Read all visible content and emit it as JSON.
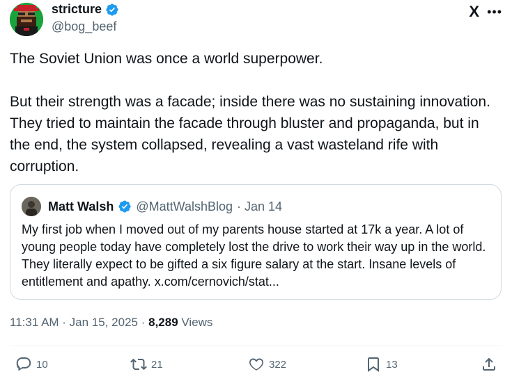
{
  "author": {
    "display_name": "stricture",
    "handle": "@bog_beef",
    "avatar_icon": "pixel-art-avatar",
    "verified_icon": "verified-badge-icon"
  },
  "top_icons": {
    "brand": "X",
    "more": "•••"
  },
  "tweet": {
    "paragraph_1": "The Soviet Union was once a world superpower.",
    "paragraph_2": "But their strength was a facade; inside there was no sustaining innovation. They tried to maintain the facade through bluster and propaganda, but in the end, the system collapsed, revealing a vast wasteland rife with corruption."
  },
  "quote": {
    "display_name": "Matt Walsh",
    "handle": "@MattWalshBlog",
    "date": "· Jan 14",
    "text": "My first job when I moved out of my parents house started at 17k a year. A lot of young people today have completely lost the drive to work their way up in the world. They literally expect to be gifted a six figure salary at the start. Insane levels of entitlement and apathy. x.com/cernovich/stat..."
  },
  "meta": {
    "timestamp": "11:31 AM · Jan 15, 2025 ·",
    "views_count": "8,289",
    "views_label": "Views"
  },
  "actions": {
    "replies": "10",
    "reposts": "21",
    "likes": "322",
    "bookmarks": "13"
  },
  "colors": {
    "text": "#0f1419",
    "secondary": "#536471",
    "verified": "#1d9bf0",
    "border": "#cfd9de"
  }
}
